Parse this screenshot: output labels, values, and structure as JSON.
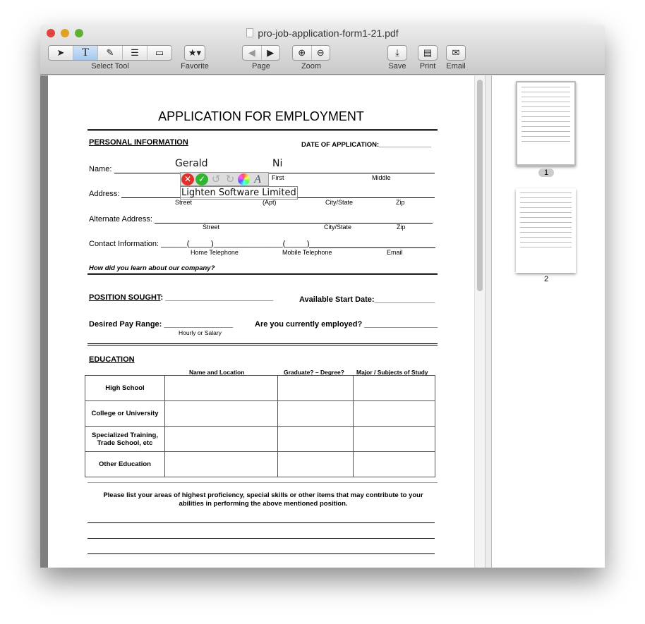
{
  "window": {
    "title": "pro-job-application-form1-21.pdf"
  },
  "toolbar": {
    "select_tool": "Select Tool",
    "favorite": "Favorite",
    "page": "Page",
    "zoom": "Zoom",
    "save": "Save",
    "print": "Print",
    "email": "Email",
    "text_tool_glyph": "T"
  },
  "document": {
    "title": "APPLICATION FOR EMPLOYMENT",
    "personal_info": "PERSONAL INFORMATION",
    "date_of_application": "DATE OF APPLICATION:______________",
    "name_label": "Name: ",
    "first": "First",
    "middle": "Middle",
    "address_label": "Address:",
    "street": "Street",
    "apt": "(Apt)",
    "city_state": "City/State",
    "zip": "Zip",
    "alt_address_label": "Alternate Address:",
    "contact_label": "Contact Information: ______(_____)________________(_____)",
    "home_tel": "Home Telephone",
    "mobile_tel": "Mobile Telephone",
    "email": "Email",
    "how_learn": "How did you learn about our company?",
    "position_sought": "POSITION SOUGHT",
    "position_line": ": _________________________",
    "start_date": "Available Start Date:______________",
    "pay_range": "Desired Pay Range:  ________________",
    "hourly_salary": "Hourly or Salary",
    "employed": "Are you currently employed? _________________",
    "education": "EDUCATION",
    "edu_headers": [
      "Name and Location",
      "Graduate? – Degree?",
      "Major / Subjects of Study"
    ],
    "edu_rows": [
      "High School",
      "College or University",
      "Specialized Training, Trade School, etc",
      "Other Education"
    ],
    "proficiency": "Please list your areas of highest proficiency, special skills or other items that may contribute to your abilities in performing the above mentioned position."
  },
  "annotations": {
    "first_name": "Gerald",
    "last_name": "Ni",
    "text_box": "Lighten Software Limited"
  },
  "thumbnails": [
    {
      "label": "1",
      "selected": true
    },
    {
      "label": "2",
      "selected": false
    }
  ]
}
